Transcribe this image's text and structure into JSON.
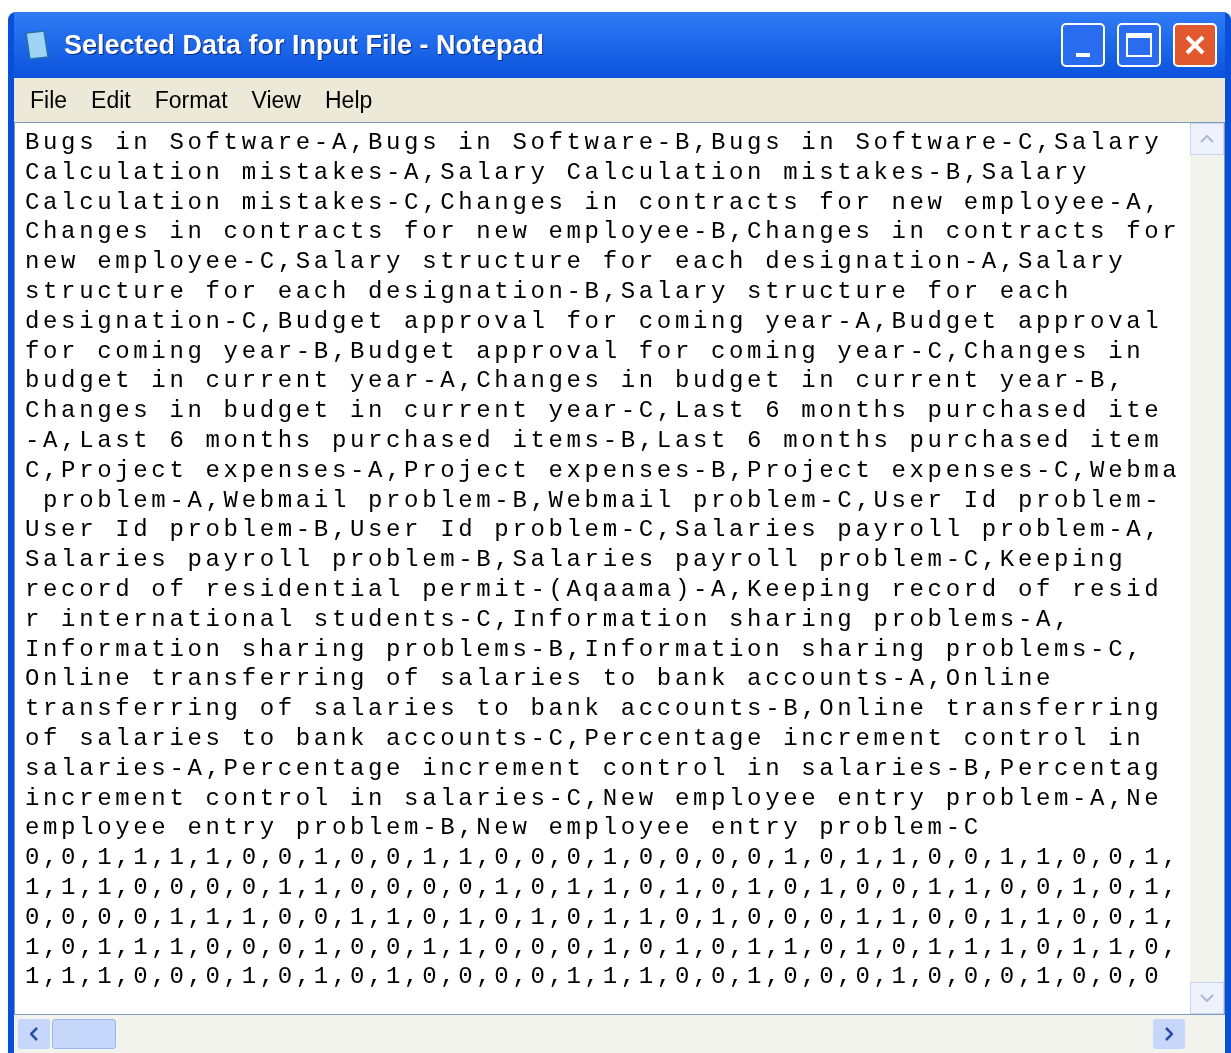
{
  "window": {
    "title": "Selected Data for Input File - Notepad"
  },
  "menu": [
    "File",
    "Edit",
    "Format",
    "View",
    "Help"
  ],
  "lines": [
    "Bugs in Software-A,Bugs in Software-B,Bugs in Software-C,Salary",
    "Calculation mistakes-A,Salary Calculation mistakes-B,Salary",
    "Calculation mistakes-C,Changes in contracts for new employee-A,",
    "Changes in contracts for new employee-B,Changes in contracts for",
    "new employee-C,Salary structure for each designation-A,Salary",
    "structure for each designation-B,Salary structure for each",
    "designation-C,Budget approval for coming year-A,Budget approval",
    "for coming year-B,Budget approval for coming year-C,Changes in",
    "budget in current year-A,Changes in budget in current year-B,",
    "Changes in budget in current year-C,Last 6 months purchased ite",
    "-A,Last 6 months purchased items-B,Last 6 months purchased item",
    "C,Project expenses-A,Project expenses-B,Project expenses-C,Webma",
    " problem-A,Webmail problem-B,Webmail problem-C,User Id problem-",
    "User Id problem-B,User Id problem-C,Salaries payroll problem-A,",
    "Salaries payroll problem-B,Salaries payroll problem-C,Keeping",
    "record of residential permit-(Aqaama)-A,Keeping record of resid",
    "r international students-C,Information sharing problems-A,",
    "Information sharing problems-B,Information sharing problems-C,",
    "Online transferring of salaries to bank accounts-A,Online",
    "transferring of salaries to bank accounts-B,Online transferring",
    "of salaries to bank accounts-C,Percentage increment control in",
    "salaries-A,Percentage increment control in salaries-B,Percentag",
    "increment control in salaries-C,New employee entry problem-A,Ne",
    "employee entry problem-B,New employee entry problem-C",
    "0,0,1,1,1,1,0,0,1,0,0,1,1,0,0,0,1,0,0,0,0,1,0,1,1,0,0,1,1,0,0,1,",
    "1,1,1,0,0,0,0,1,1,0,0,0,0,1,0,1,1,0,1,0,1,0,1,0,0,1,1,0,0,1,0,1,",
    "0,0,0,0,1,1,1,0,0,1,1,0,1,0,1,0,1,1,0,1,0,0,0,1,1,0,0,1,1,0,0,1,",
    "1,0,1,1,1,0,0,0,1,0,0,1,1,0,0,0,1,0,1,0,1,1,0,1,0,1,1,1,0,1,1,0,",
    "1,1,1,0,0,0,1,0,1,0,1,0,0,0,0,1,1,1,0,0,1,0,0,0,1,0,0,0,1,0,0,0"
  ]
}
